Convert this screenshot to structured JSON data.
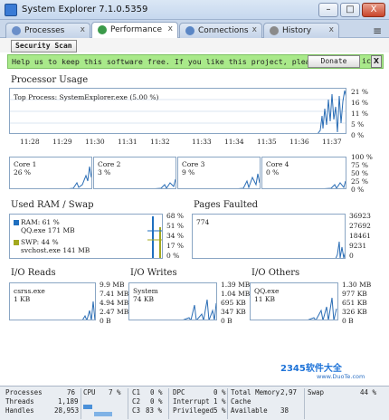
{
  "window": {
    "title": "System Explorer 7.1.0.5359",
    "minimize": "–",
    "maximize": "□",
    "close": "X"
  },
  "tabs": [
    {
      "label": "Processes",
      "active": false
    },
    {
      "label": "Performance",
      "active": true
    },
    {
      "label": "Connections",
      "active": false
    },
    {
      "label": "History",
      "active": false
    }
  ],
  "tab_close": "x",
  "menu_icon": "≡",
  "toolbar": {
    "scan_label": "Security Scan"
  },
  "banner": {
    "text": "Help us to keep this software free.  If you like this project, plea",
    "tail": "ic",
    "donate_label": "Donate",
    "close_label": "X"
  },
  "processor": {
    "title": "Processor Usage",
    "top_process": "Top Process: SystemExplorer.exe (5.00 %)",
    "axis": [
      "21 %",
      "16 %",
      "11 %",
      "5 %",
      "0 %"
    ],
    "times": [
      "11:28",
      "11:29",
      "11:30",
      "11:31",
      "11:32",
      "11:33",
      "11:34",
      "11:35",
      "11:36",
      "11:37"
    ]
  },
  "cores": {
    "items": [
      {
        "label": "Core 1",
        "value": "26 %"
      },
      {
        "label": "Core 2",
        "value": "3 %"
      },
      {
        "label": "Core 3",
        "value": "9 %"
      },
      {
        "label": "Core 4",
        "value": "0 %"
      }
    ],
    "axis": [
      "100 %",
      "75 %",
      "50 %",
      "25 %",
      "0 %"
    ]
  },
  "ram": {
    "title": "Used RAM / Swap",
    "ram_label": "RAM: 61 %",
    "ram_proc": "QQ.exe 171 MB",
    "swp_label": "SWP: 44 %",
    "swp_proc": "svchost.exe 141 MB",
    "axis": [
      "68 %",
      "51 %",
      "34 %",
      "17 %",
      "0 %"
    ],
    "ram_color": "#1f6fbf",
    "swp_color": "#a3a81e"
  },
  "pages": {
    "title": "Pages Faulted",
    "value": "774",
    "axis": [
      "36923",
      "27692",
      "18461",
      "9231",
      "0"
    ]
  },
  "io_reads": {
    "title": "I/O Reads",
    "proc": "csrss.exe",
    "value": "1 KB",
    "axis": [
      "9.9 MB",
      "7.41 MB",
      "4.94 MB",
      "2.47 MB",
      "0 B"
    ]
  },
  "io_writes": {
    "title": "I/O Writes",
    "proc": "System",
    "value": "74 KB",
    "axis": [
      "1.39 MB",
      "1.04 MB",
      "695 KB",
      "347 KB",
      "0 B"
    ]
  },
  "io_others": {
    "title": "I/O Others",
    "proc": "QQ.exe",
    "value": "11 KB",
    "axis": [
      "1.30 MB",
      "977 KB",
      "651 KB",
      "326 KB",
      "0 B"
    ]
  },
  "status": {
    "processes_label": "Processes",
    "processes_value": "76",
    "threads_label": "Threads",
    "threads_value": "1,189",
    "handles_label": "Handles",
    "handles_value": "28,953",
    "cpu_label": "CPU",
    "cpu_value": "7 %",
    "c1_label": "C1",
    "c1_value": "0 %",
    "c2_label": "C2",
    "c2_value": "0 %",
    "c3_label": "C3",
    "c3_value": "83 %",
    "dpc_label": "DPC",
    "dpc_value": "0 %",
    "interrupt_label": "Interrupt",
    "interrupt_value": "1 %",
    "privileged_label": "Privileged",
    "privileged_value": "5 %",
    "total_label": "Total Memory",
    "total_value": "2,97",
    "cache_label": "Cache",
    "cache_value": "",
    "avail_label": "Available",
    "avail_value": "38",
    "swap_label": "Swap",
    "swap_value": "44 %"
  },
  "watermark": {
    "line1": "2345软件大全",
    "line2": "www.DuoTe.com"
  }
}
